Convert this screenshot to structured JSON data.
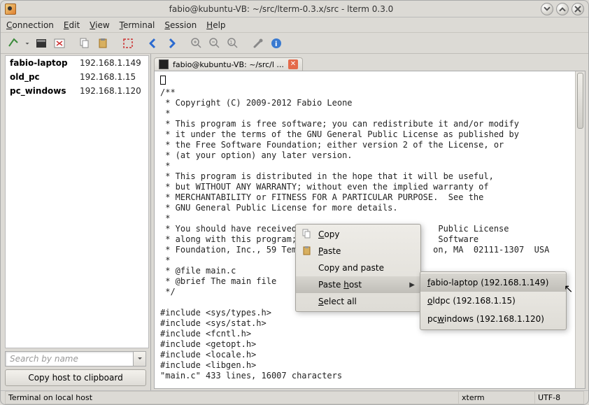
{
  "window": {
    "title": "fabio@kubuntu-VB: ~/src/lterm-0.3.x/src - lterm 0.3.0"
  },
  "menubar": {
    "items": [
      {
        "label": "Connection",
        "accel": "C"
      },
      {
        "label": "Edit",
        "accel": "E"
      },
      {
        "label": "View",
        "accel": "V"
      },
      {
        "label": "Terminal",
        "accel": "T"
      },
      {
        "label": "Session",
        "accel": "S"
      },
      {
        "label": "Help",
        "accel": "H"
      }
    ]
  },
  "sidebar": {
    "hosts": [
      {
        "name": "fabio-laptop",
        "ip": "192.168.1.149"
      },
      {
        "name": "old_pc",
        "ip": "192.168.1.15"
      },
      {
        "name": "pc_windows",
        "ip": "192.168.1.120"
      }
    ],
    "search_placeholder": "Search by name",
    "copy_button": "Copy host to clipboard"
  },
  "tabs": {
    "active": {
      "label": "fabio@kubuntu-VB: ~/src/l ..."
    }
  },
  "terminal": {
    "lines": [
      "/**",
      " * Copyright (C) 2009-2012 Fabio Leone",
      " *",
      " * This program is free software; you can redistribute it and/or modify",
      " * it under the terms of the GNU General Public License as published by",
      " * the Free Software Foundation; either version 2 of the License, or",
      " * (at your option) any later version.",
      " *",
      " * This program is distributed in the hope that it will be useful,",
      " * but WITHOUT ANY WARRANTY; without even the implied warranty of",
      " * MERCHANTABILITY or FITNESS FOR A PARTICULAR PURPOSE.  See the",
      " * GNU General Public License for more details.",
      " *",
      " * You should have received                            Public License",
      " * along with this program;                            Software",
      " * Foundation, Inc., 59 Tem                           on, MA  02111-1307  USA",
      " *",
      " * @file main.c",
      " * @brief The main file",
      " */",
      "",
      "#include <sys/types.h>",
      "#include <sys/stat.h>",
      "#include <fcntl.h>",
      "#include <getopt.h>",
      "#include <locale.h>",
      "#include <libgen.h>",
      "\"main.c\" 433 lines, 16007 characters"
    ]
  },
  "context_menu": {
    "items": [
      {
        "label": "Copy",
        "accel": "C",
        "icon": "copy"
      },
      {
        "label": "Paste",
        "accel": "P",
        "icon": "paste"
      },
      {
        "label": "Copy and paste",
        "accel": null,
        "icon": null
      },
      {
        "label": "Paste host",
        "accel": "h",
        "icon": null,
        "submenu": true,
        "highlighted": true
      },
      {
        "label": "Select all",
        "accel": "S",
        "icon": null
      }
    ]
  },
  "submenu": {
    "items": [
      {
        "label": "fabio-laptop (192.168.1.149)",
        "accel": "f",
        "highlighted": true
      },
      {
        "label": "oldpc (192.168.1.15)",
        "accel": "o"
      },
      {
        "label": "pcwindows (192.168.1.120)",
        "accel": "w"
      }
    ]
  },
  "statusbar": {
    "left": "Terminal on local host",
    "mid": "xterm",
    "right": "UTF-8"
  }
}
